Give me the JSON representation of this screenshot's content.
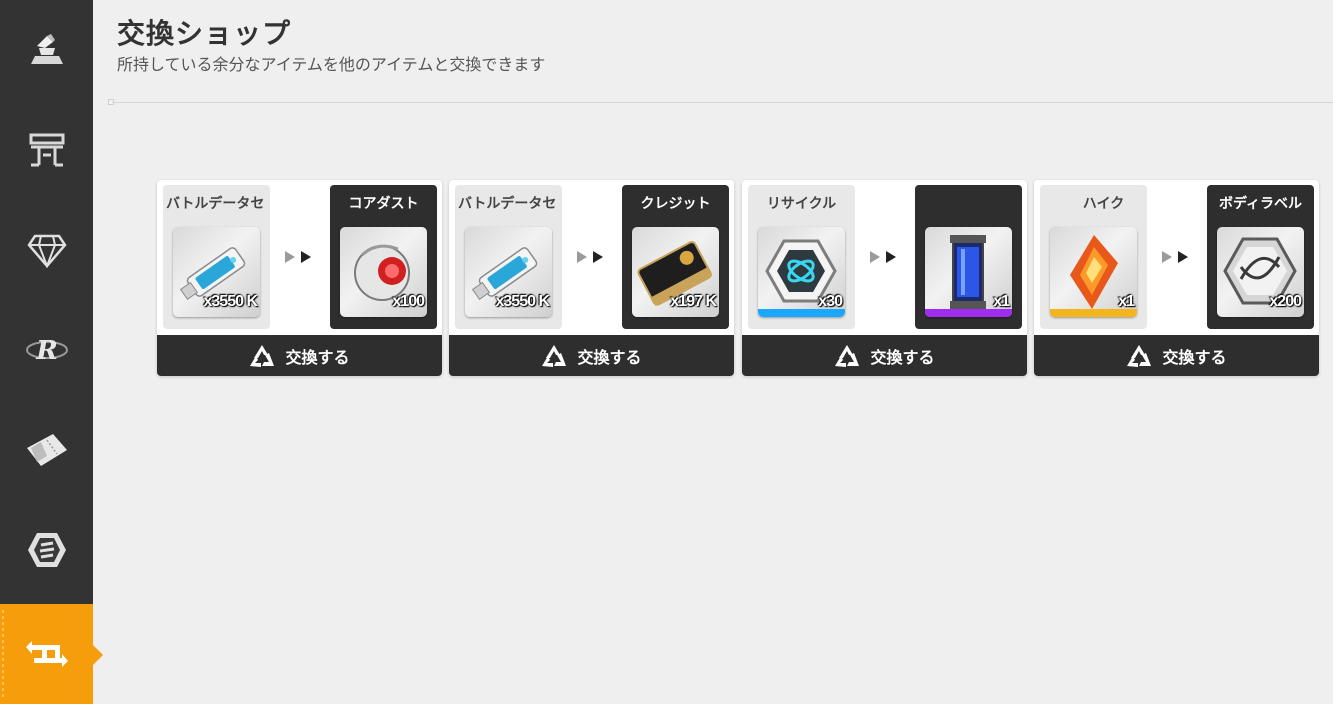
{
  "header": {
    "title": "交換ショップ",
    "subtitle": "所持している余分なアイテムを他のアイテムと交換できます"
  },
  "sidebar": {
    "items": [
      {
        "icon": "anvil-icon",
        "active": false
      },
      {
        "icon": "layout-icon",
        "active": false
      },
      {
        "icon": "diamond-icon",
        "active": false
      },
      {
        "icon": "r-logo-icon",
        "active": false
      },
      {
        "icon": "ticket-icon",
        "active": false
      },
      {
        "icon": "hex-token-icon",
        "active": false
      },
      {
        "icon": "exchange-arrows-icon",
        "active": true
      }
    ],
    "active_color": "#f59d0b"
  },
  "cards": [
    {
      "from": {
        "name": "バトルデータセ",
        "qty": "x3550 K",
        "icon": "usb-drive-icon",
        "rarity": "none"
      },
      "to": {
        "name": "コアダスト",
        "qty": "x100",
        "icon": "core-dust-icon",
        "rarity": "none"
      },
      "button_label": "交換する"
    },
    {
      "from": {
        "name": "バトルデータセ",
        "qty": "x3550 K",
        "icon": "usb-drive-icon",
        "rarity": "none"
      },
      "to": {
        "name": "クレジット",
        "qty": "x197 K",
        "icon": "credit-card-icon",
        "rarity": "none"
      },
      "button_label": "交換する"
    },
    {
      "from": {
        "name": "リサイクル",
        "qty": "x30",
        "icon": "recycle-hex-icon",
        "rarity": "blue"
      },
      "to": {
        "name": "",
        "qty": "x1",
        "icon": "cylinder-icon",
        "rarity": "purple"
      },
      "button_label": "交換する"
    },
    {
      "from": {
        "name": "ハイク",
        "qty": "x1",
        "icon": "crystal-icon",
        "rarity": "gold"
      },
      "to": {
        "name": "ボディラベル",
        "qty": "x200",
        "icon": "dna-label-icon",
        "rarity": "none"
      },
      "button_label": "交換する"
    }
  ],
  "colors": {
    "accent": "#f59d0b",
    "dark_panel": "#2e2e2e",
    "rarity_blue": "#1aa7ff",
    "rarity_purple": "#a02cf0",
    "rarity_gold": "#f4b51c"
  }
}
